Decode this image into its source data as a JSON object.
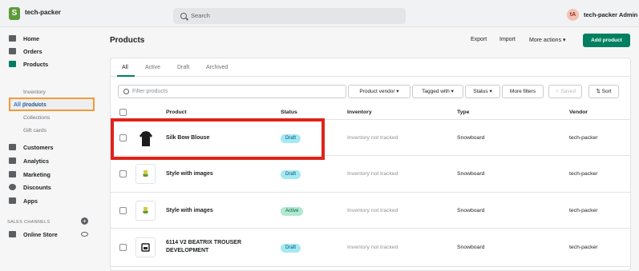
{
  "topbar": {
    "store": "tech-packer",
    "search_placeholder": "Search",
    "avatar_initials": "tA",
    "admin": "tech-packer Admin",
    "logo": "S"
  },
  "sidebar": {
    "items": [
      {
        "label": "Home"
      },
      {
        "label": "Orders"
      },
      {
        "label": "Products"
      }
    ],
    "product_sub": [
      "All products",
      "Inventory",
      "Transfers",
      "Collections",
      "Gift cards"
    ],
    "items2": [
      {
        "label": "Customers"
      },
      {
        "label": "Analytics"
      },
      {
        "label": "Marketing"
      },
      {
        "label": "Discounts"
      },
      {
        "label": "Apps"
      }
    ],
    "channels_heading": "SALES CHANNELS",
    "online_store": "Online Store"
  },
  "header": {
    "title": "Products",
    "export": "Export",
    "import": "Import",
    "more_actions": "More actions ▾",
    "add_product": "Add product"
  },
  "tabs": [
    "All",
    "Active",
    "Draft",
    "Archived"
  ],
  "filters": {
    "placeholder": "Filter products",
    "vendor": "Product vendor ▾",
    "tagged": "Tagged with ▾",
    "status": "Status ▾",
    "more": "More filters",
    "saved": "☆ Saved",
    "sort": "⇅ Sort"
  },
  "columns": [
    "Product",
    "Status",
    "Inventory",
    "Type",
    "Vendor"
  ],
  "rows": [
    {
      "name": "Silk Bow Blouse",
      "name2": "",
      "status": "Draft",
      "inventory": "Inventory not tracked",
      "type": "Snowboard",
      "vendor": "tech-packer"
    },
    {
      "name": "Style with images",
      "name2": "",
      "status": "Draft",
      "inventory": "Inventory not tracked",
      "type": "Snowboard",
      "vendor": "tech-packer"
    },
    {
      "name": "Style with images",
      "name2": "",
      "status": "Active",
      "inventory": "Inventory not tracked",
      "type": "Snowboard",
      "vendor": "tech-packer"
    },
    {
      "name": "6114 V2 BEATRIX TROUSER",
      "name2": "DEVELOPMENT",
      "status": "Draft",
      "inventory": "Inventory not tracked",
      "type": "Snowboard",
      "vendor": "tech-packer"
    }
  ],
  "colors": {
    "accent": "#008060",
    "highlight_box": "#e0221a",
    "selected_outline": "#f29a3a",
    "draft_badge": "#a4e8f2",
    "active_badge": "#aee9d1"
  }
}
